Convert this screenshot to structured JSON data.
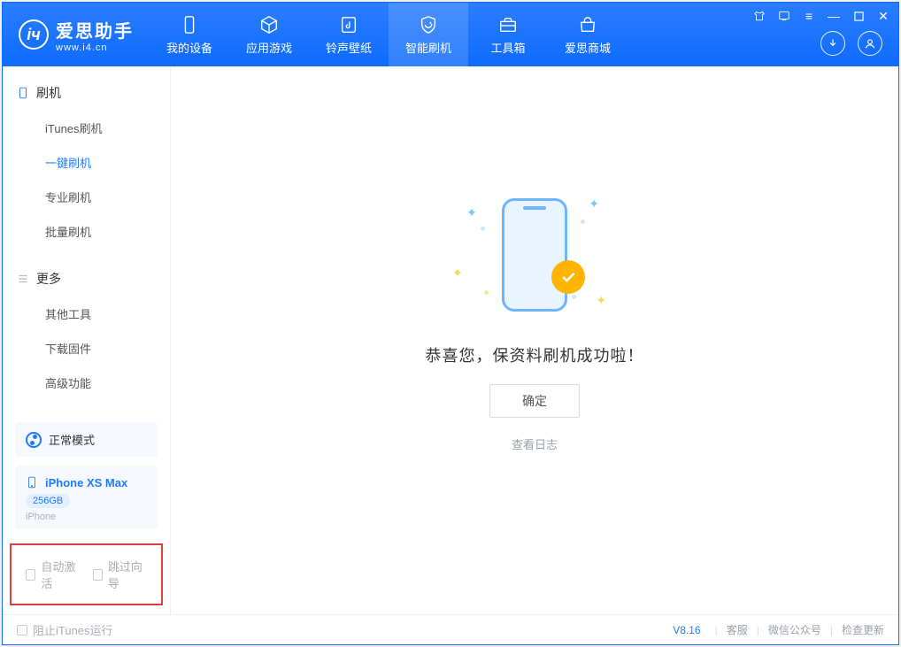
{
  "app": {
    "name_cn": "爱思助手",
    "url": "www.i4.cn"
  },
  "tabs": [
    {
      "label": "我的设备"
    },
    {
      "label": "应用游戏"
    },
    {
      "label": "铃声壁纸"
    },
    {
      "label": "智能刷机"
    },
    {
      "label": "工具箱"
    },
    {
      "label": "爱思商城"
    }
  ],
  "sidebar": {
    "group1": {
      "title": "刷机",
      "items": [
        "iTunes刷机",
        "一键刷机",
        "专业刷机",
        "批量刷机"
      ]
    },
    "group2": {
      "title": "更多",
      "items": [
        "其他工具",
        "下载固件",
        "高级功能"
      ]
    }
  },
  "mode": {
    "label": "正常模式"
  },
  "device": {
    "name": "iPhone XS Max",
    "storage": "256GB",
    "type": "iPhone"
  },
  "checkboxes": {
    "auto_activate": "自动激活",
    "skip_guide": "跳过向导"
  },
  "main": {
    "success_text": "恭喜您，保资料刷机成功啦！",
    "ok": "确定",
    "view_log": "查看日志"
  },
  "status": {
    "block_itunes": "阻止iTunes运行",
    "version": "V8.16",
    "links": [
      "客服",
      "微信公众号",
      "检查更新"
    ]
  }
}
